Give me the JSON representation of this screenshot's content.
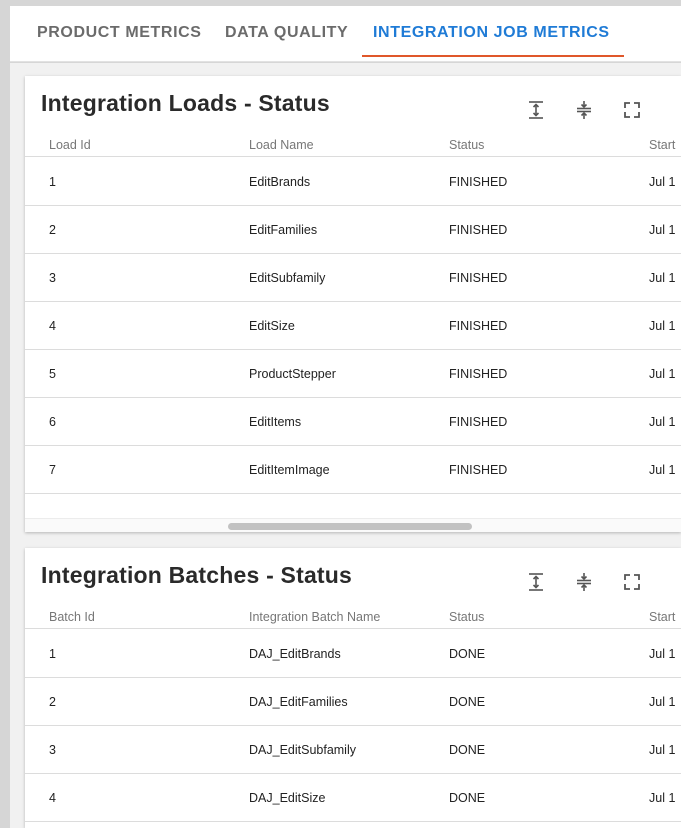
{
  "tabs": [
    {
      "label": "PRODUCT METRICS",
      "active": false
    },
    {
      "label": "DATA QUALITY",
      "active": false
    },
    {
      "label": "INTEGRATION JOB METRICS",
      "active": true
    }
  ],
  "colors": {
    "active_tab": "#1f7bd6",
    "tab_underline": "#e0572a"
  },
  "loads": {
    "title": "Integration Loads - Status",
    "tools": [
      "expand-rows-icon",
      "collapse-rows-icon",
      "fullscreen-icon"
    ],
    "columns": [
      "Load Id",
      "Load Name",
      "Status",
      "Start"
    ],
    "rows": [
      [
        "1",
        "EditBrands",
        "FINISHED",
        "Jul 1"
      ],
      [
        "2",
        "EditFamilies",
        "FINISHED",
        "Jul 1"
      ],
      [
        "3",
        "EditSubfamily",
        "FINISHED",
        "Jul 1"
      ],
      [
        "4",
        "EditSize",
        "FINISHED",
        "Jul 1"
      ],
      [
        "5",
        "ProductStepper",
        "FINISHED",
        "Jul 1"
      ],
      [
        "6",
        "EditItems",
        "FINISHED",
        "Jul 1"
      ],
      [
        "7",
        "EditItemImage",
        "FINISHED",
        "Jul 1"
      ]
    ]
  },
  "batches": {
    "title": "Integration Batches - Status",
    "tools": [
      "expand-rows-icon",
      "collapse-rows-icon",
      "fullscreen-icon"
    ],
    "columns": [
      "Batch Id",
      "Integration Batch Name",
      "Status",
      "Start"
    ],
    "rows": [
      [
        "1",
        "DAJ_EditBrands",
        "DONE",
        "Jul 1"
      ],
      [
        "2",
        "DAJ_EditFamilies",
        "DONE",
        "Jul 1"
      ],
      [
        "3",
        "DAJ_EditSubfamily",
        "DONE",
        "Jul 1"
      ],
      [
        "4",
        "DAJ_EditSize",
        "DONE",
        "Jul 1"
      ]
    ]
  }
}
